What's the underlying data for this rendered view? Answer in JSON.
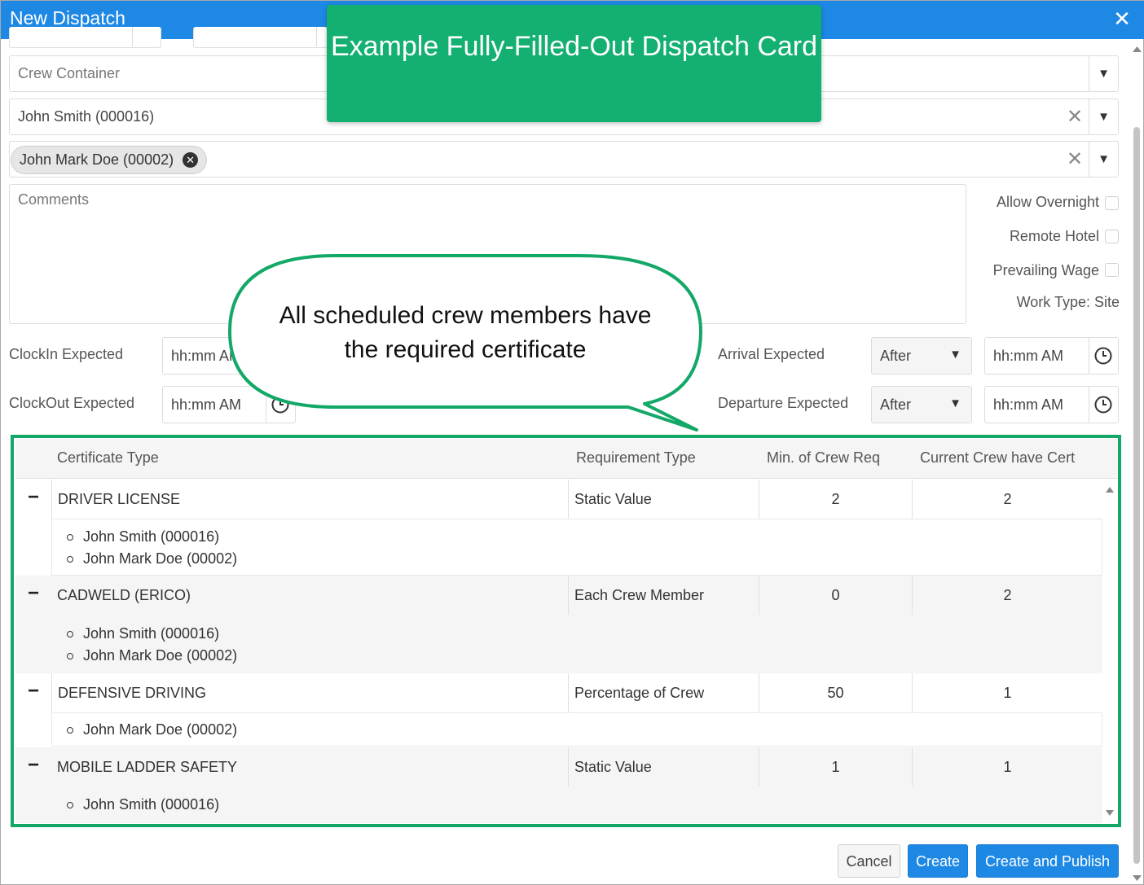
{
  "window": {
    "title": "New Dispatch"
  },
  "form": {
    "crew_container_placeholder": "Crew Container",
    "crew_lead_value": "John Smith (000016)",
    "crew_members": [
      "John Mark Doe (00002)"
    ],
    "comments_placeholder": "Comments",
    "checkboxes": [
      {
        "label": "Allow Overnight",
        "checked": false
      },
      {
        "label": "Remote Hotel",
        "checked": false
      },
      {
        "label": "Prevailing Wage",
        "checked": false
      }
    ],
    "work_type": "Work Type: Site",
    "clockin_label": "ClockIn Expected",
    "clockin_value": "hh:mm AM",
    "clockout_label": "ClockOut Expected",
    "clockout_value": "hh:mm AM",
    "arrival_label": "Arrival Expected",
    "arrival_select": "After",
    "arrival_time": "hh:mm AM",
    "departure_label": "Departure Expected",
    "departure_select": "After",
    "departure_time": "hh:mm AM"
  },
  "grid": {
    "columns": [
      "Certificate Type",
      "Requirement Type",
      "Min. of Crew Req",
      "Current Crew have Cert"
    ],
    "rows": [
      {
        "certificate": "DRIVER LICENSE",
        "requirement": "Static Value",
        "min": "2",
        "current": "2",
        "members": [
          "John Smith (000016)",
          "John Mark Doe (00002)"
        ]
      },
      {
        "certificate": "CADWELD (ERICO)",
        "requirement": "Each Crew Member",
        "min": "0",
        "current": "2",
        "members": [
          "John Smith (000016)",
          "John Mark Doe (00002)"
        ]
      },
      {
        "certificate": "DEFENSIVE DRIVING",
        "requirement": "Percentage of Crew",
        "min": "50",
        "current": "1",
        "members": [
          "John Mark Doe (00002)"
        ]
      },
      {
        "certificate": "MOBILE LADDER SAFETY",
        "requirement": "Static Value",
        "min": "1",
        "current": "1",
        "members": [
          "John Smith (000016)"
        ]
      }
    ]
  },
  "buttons": {
    "cancel": "Cancel",
    "create": "Create",
    "create_publish": "Create and Publish"
  },
  "callouts": {
    "banner": "Example Fully-Filled-Out Dispatch Card",
    "bubble": "All scheduled crew members have the required certificate"
  },
  "colors": {
    "titlebar": "#1e88e5",
    "callout_green": "#13b071",
    "highlight_border": "#13a868",
    "primary_button": "#1e88e5"
  },
  "icons": [
    "close-icon",
    "chevron-down-icon",
    "clear-icon",
    "chip-remove-icon",
    "clock-icon",
    "collapse-minus-icon",
    "scroll-up-icon",
    "scroll-down-icon"
  ]
}
